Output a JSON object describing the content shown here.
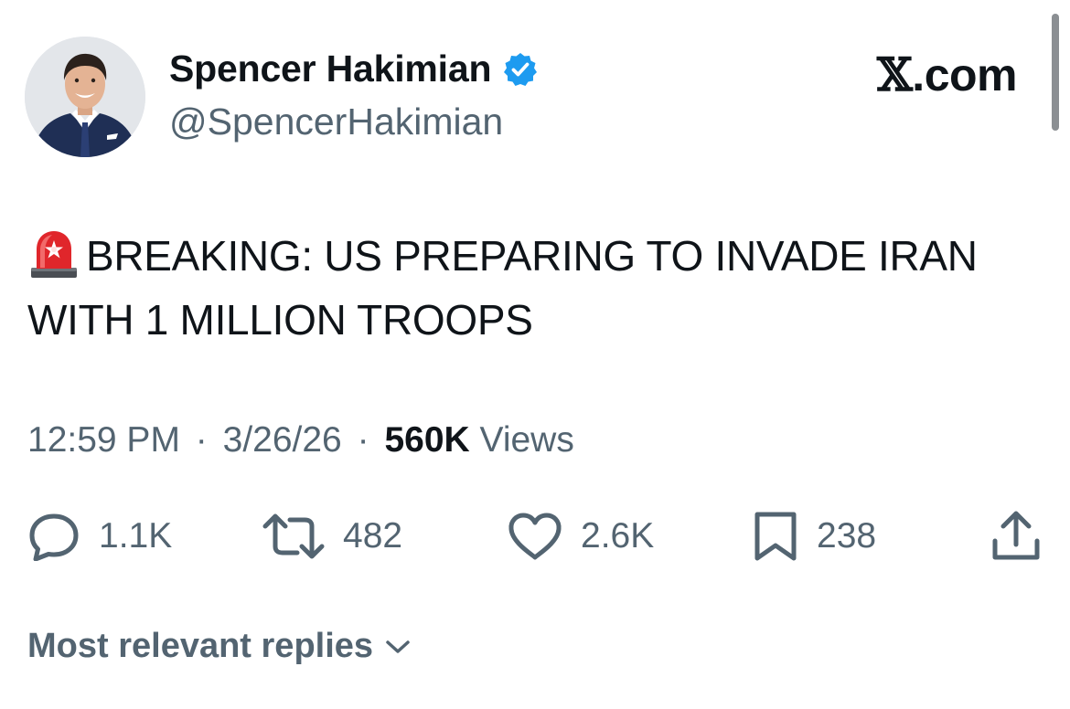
{
  "author": {
    "display_name": "Spencer Hakimian",
    "handle": "@SpencerHakimian",
    "verified": true,
    "verified_color": "#1d9bf0"
  },
  "brand": {
    "x": "𝕏",
    "domain": ".com"
  },
  "tweet": {
    "icon": "police-siren-emoji",
    "text": "BREAKING: US PREPARING TO INVADE IRAN WITH 1 MILLION TROOPS"
  },
  "meta": {
    "time": "12:59 PM",
    "separator": "·",
    "date": "3/26/26",
    "views_count": "560K",
    "views_label": "Views"
  },
  "actions": {
    "replies": {
      "icon": "reply-icon",
      "count": "1.1K"
    },
    "reposts": {
      "icon": "repost-icon",
      "count": "482"
    },
    "likes": {
      "icon": "heart-icon",
      "count": "2.6K"
    },
    "bookmarks": {
      "icon": "bookmark-icon",
      "count": "238"
    },
    "share": {
      "icon": "share-icon"
    }
  },
  "replies_sort": {
    "label": "Most relevant replies",
    "icon": "chevron-down-icon"
  },
  "colors": {
    "text_primary": "#0f1419",
    "text_secondary": "#536471",
    "siren_red": "#e0262b"
  }
}
